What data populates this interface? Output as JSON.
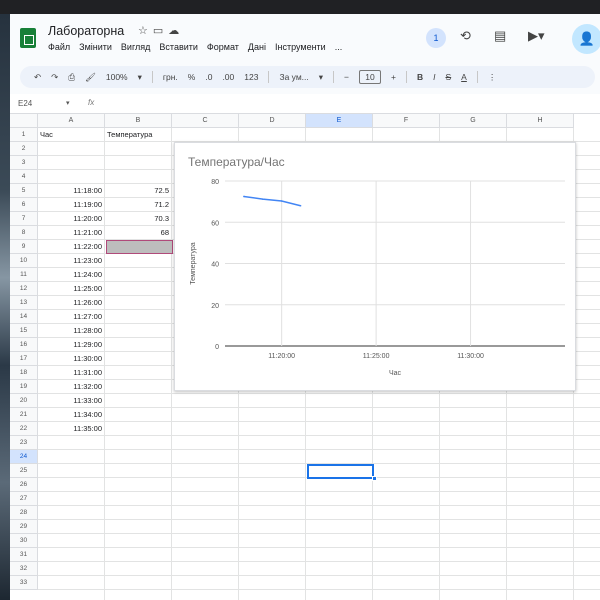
{
  "app": {
    "title": "Лабораторна",
    "menu": [
      "Файл",
      "Змінити",
      "Вигляд",
      "Вставити",
      "Формат",
      "Дані",
      "Інструменти",
      "..."
    ],
    "badge": "1"
  },
  "toolbar": {
    "zoom": "100%",
    "currency": "грн.",
    "percent": "%",
    "dec_dec": ".0",
    "dec_inc": ".00",
    "number_format": "123",
    "font": "За ум...",
    "font_size": "10",
    "bold": "B",
    "italic": "I",
    "strike": "S",
    "text_color": "A"
  },
  "formula_bar": {
    "cell_ref": "E24",
    "fx": "fx",
    "value": ""
  },
  "grid": {
    "columns": [
      "A",
      "B",
      "C",
      "D",
      "E",
      "F",
      "G",
      "H"
    ],
    "selected_column": "E",
    "selected_row": "24",
    "rows": [
      "1",
      "2",
      "3",
      "4",
      "5",
      "6",
      "7",
      "8",
      "9",
      "10",
      "11",
      "12",
      "13",
      "14",
      "15",
      "16",
      "17",
      "18",
      "19",
      "20",
      "21",
      "22",
      "23",
      "24",
      "25",
      "26",
      "27",
      "28",
      "29",
      "30",
      "31",
      "32",
      "33"
    ],
    "cells": {
      "A1": "Час",
      "B1": "Температура",
      "A5": "11:18:00",
      "B5": "72.5",
      "A6": "11:19:00",
      "B6": "71.2",
      "A7": "11:20:00",
      "B7": "70.3",
      "A8": "11:21:00",
      "B8": "68",
      "A9": "11:22:00",
      "A10": "11:23:00",
      "A11": "11:24:00",
      "A12": "11:25:00",
      "A13": "11:26:00",
      "A14": "11:27:00",
      "A15": "11:28:00",
      "A16": "11:29:00",
      "A17": "11:30:00",
      "A18": "11:31:00",
      "A19": "11:32:00",
      "A20": "11:33:00",
      "A21": "11:34:00",
      "A22": "11:35:00"
    }
  },
  "chart_data": {
    "type": "line",
    "title": "Температура/Час",
    "xlabel": "Час",
    "ylabel": "Температура",
    "x_ticks": [
      "11:20:00",
      "11:25:00",
      "11:30:00"
    ],
    "y_ticks": [
      0,
      20,
      40,
      60,
      80
    ],
    "ylim": [
      0,
      80
    ],
    "xlim": [
      "11:17:00",
      "11:35:00"
    ],
    "series": [
      {
        "x": [
          "11:18:00",
          "11:19:00",
          "11:20:00",
          "11:21:00"
        ],
        "values": [
          72.5,
          71.2,
          70.3,
          68
        ],
        "color": "#4285f4"
      }
    ],
    "grid": true
  }
}
